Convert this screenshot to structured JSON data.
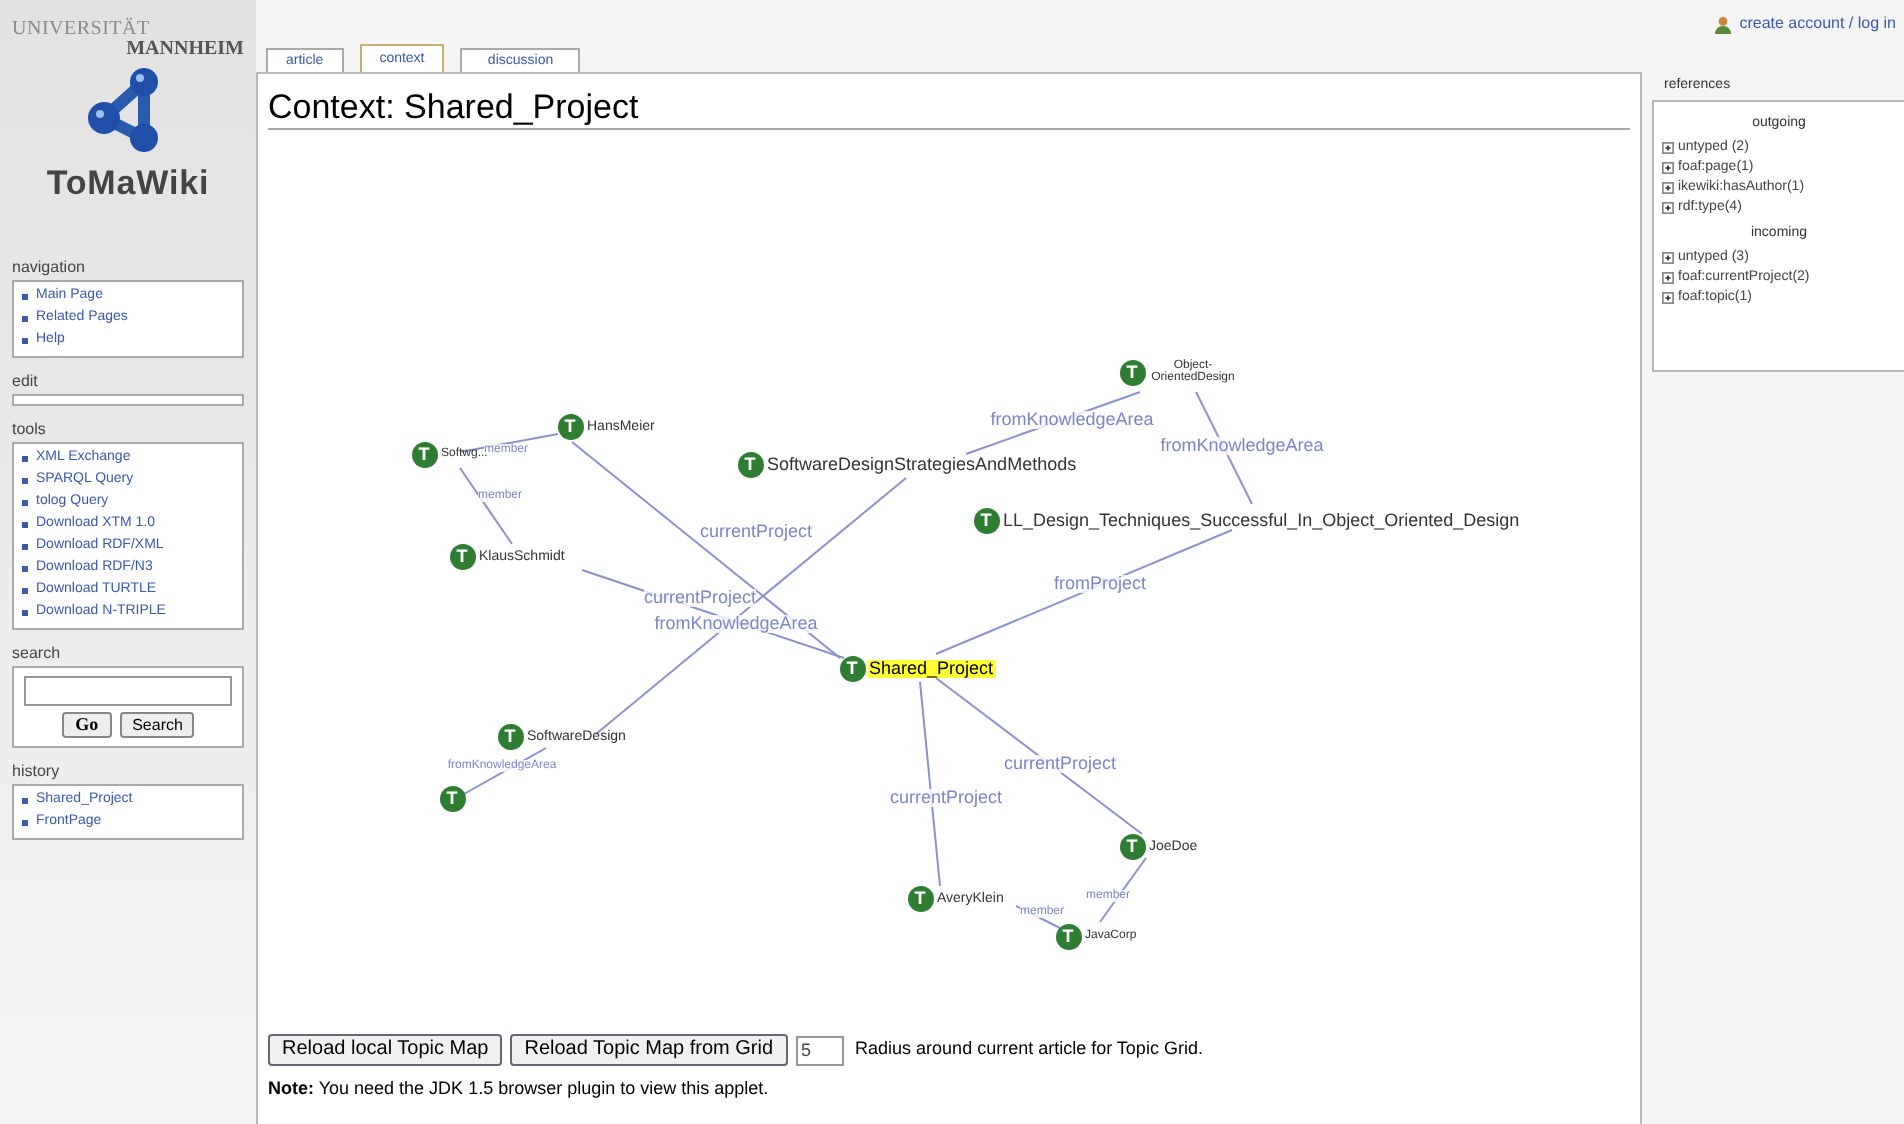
{
  "logo": {
    "university": "UNIVERSITÄT",
    "city": "MANNHEIM",
    "wiki_name": "ToMaWiki"
  },
  "sidebar": {
    "portlets": [
      {
        "title": "navigation",
        "kind": "links",
        "items": [
          "Main Page",
          "Related Pages",
          "Help"
        ]
      },
      {
        "title": "edit",
        "kind": "empty"
      },
      {
        "title": "tools",
        "kind": "links",
        "items": [
          "XML Exchange",
          "SPARQL Query",
          "tolog Query",
          "Download XTM 1.0",
          "Download RDF/XML",
          "Download RDF/N3",
          "Download TURTLE",
          "Download N-TRIPLE"
        ]
      },
      {
        "title": "search",
        "kind": "search",
        "buttons": [
          "Go",
          "Search"
        ]
      },
      {
        "title": "history",
        "kind": "links",
        "items": [
          "Shared_Project",
          "FrontPage"
        ]
      }
    ]
  },
  "tabs": [
    {
      "label": "article",
      "selected": false
    },
    {
      "label": "context",
      "selected": true
    },
    {
      "label": "discussion",
      "selected": false
    }
  ],
  "user_link": "create account / log in",
  "page_title": "Context: Shared_Project",
  "graph": {
    "nodes": [
      {
        "badge": "T",
        "label": "Softwg...",
        "highlighted": false
      },
      {
        "badge": "T",
        "label": "HansMeier",
        "highlighted": false
      },
      {
        "badge": "T",
        "label": "SoftwareDesignStrategiesAndMethods",
        "highlighted": false
      },
      {
        "badge": "T",
        "label": "Object-OrientedDesign",
        "highlighted": false
      },
      {
        "badge": "T",
        "label": "LL_Design_Techniques_Successful_In_Object_Oriented_Design",
        "highlighted": false
      },
      {
        "badge": "T",
        "label": "KlausSchmidt",
        "highlighted": false
      },
      {
        "badge": "T",
        "label": "Shared_Project",
        "highlighted": true
      },
      {
        "badge": "T",
        "label": "SoftwareDesign",
        "highlighted": false
      },
      {
        "badge": "T",
        "highlighted": false
      },
      {
        "badge": "T",
        "label": "JoeDoe",
        "highlighted": false
      },
      {
        "badge": "T",
        "label": "AveryKlein",
        "highlighted": false
      },
      {
        "badge": "T",
        "label": "JavaCorp",
        "highlighted": false
      }
    ],
    "edges": [
      {
        "label": "currentProject"
      },
      {
        "label": "currentProject"
      },
      {
        "label": "fromKnowledgeArea"
      },
      {
        "label": "fromKnowledgeArea"
      },
      {
        "label": "fromKnowledgeArea"
      },
      {
        "label": "fromProject"
      },
      {
        "label": "currentProject"
      },
      {
        "label": "currentProject"
      },
      {
        "label": "member"
      },
      {
        "label": "member"
      },
      {
        "label": "member"
      },
      {
        "label": "member"
      },
      {
        "label": "fromKnowledgeArea"
      }
    ]
  },
  "controls": {
    "buttons": [
      "Reload local Topic Map",
      "Reload Topic Map from Grid"
    ],
    "radius_value": "5",
    "radius_label": "Radius around current article for Topic Grid."
  },
  "note": "**Note:** You need the JDK 1.5 browser plugin to view this applet.",
  "references": {
    "title": "references",
    "groups": [
      {
        "heading": "outgoing",
        "items": [
          "untyped (2)",
          "foaf:page(1)",
          "ikewiki:hasAuthor(1)",
          "rdf:type(4)"
        ]
      },
      {
        "heading": "incoming",
        "items": [
          "untyped (3)",
          "foaf:currentProject(2)",
          "foaf:topic(1)"
        ]
      }
    ]
  }
}
